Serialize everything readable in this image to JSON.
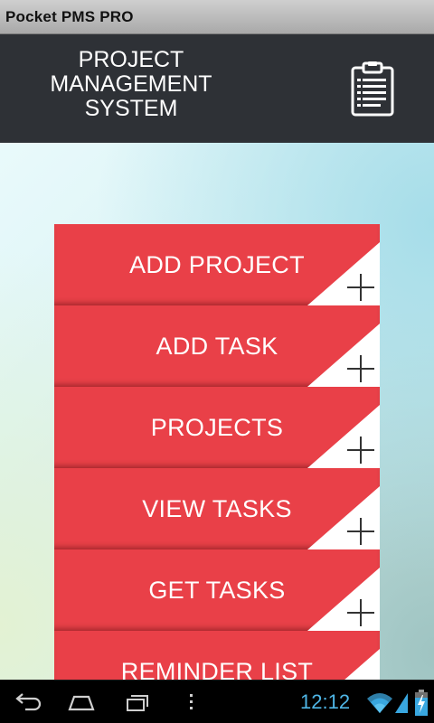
{
  "app": {
    "window_title": "Pocket PMS PRO"
  },
  "header": {
    "title_lines": [
      "PROJECT",
      "MANAGEMENT",
      "SYSTEM"
    ],
    "icon": "clipboard-icon"
  },
  "menu": {
    "items": [
      {
        "label": "ADD PROJECT",
        "icon": "plus-icon"
      },
      {
        "label": "ADD TASK",
        "icon": "plus-icon"
      },
      {
        "label": "PROJECTS",
        "icon": "plus-icon"
      },
      {
        "label": "VIEW TASKS",
        "icon": "plus-icon"
      },
      {
        "label": "GET TASKS",
        "icon": "plus-icon"
      },
      {
        "label": "REMINDER LIST",
        "icon": "plus-icon"
      }
    ]
  },
  "navbar": {
    "clock": "12:12",
    "icons": [
      "back-icon",
      "home-icon",
      "recent-apps-icon",
      "menu-dots-icon",
      "wifi-icon",
      "signal-icon",
      "battery-charging-icon"
    ]
  },
  "colors": {
    "accent": "#e94048",
    "header_bg": "#2e3136",
    "clock": "#4fb6e6"
  }
}
